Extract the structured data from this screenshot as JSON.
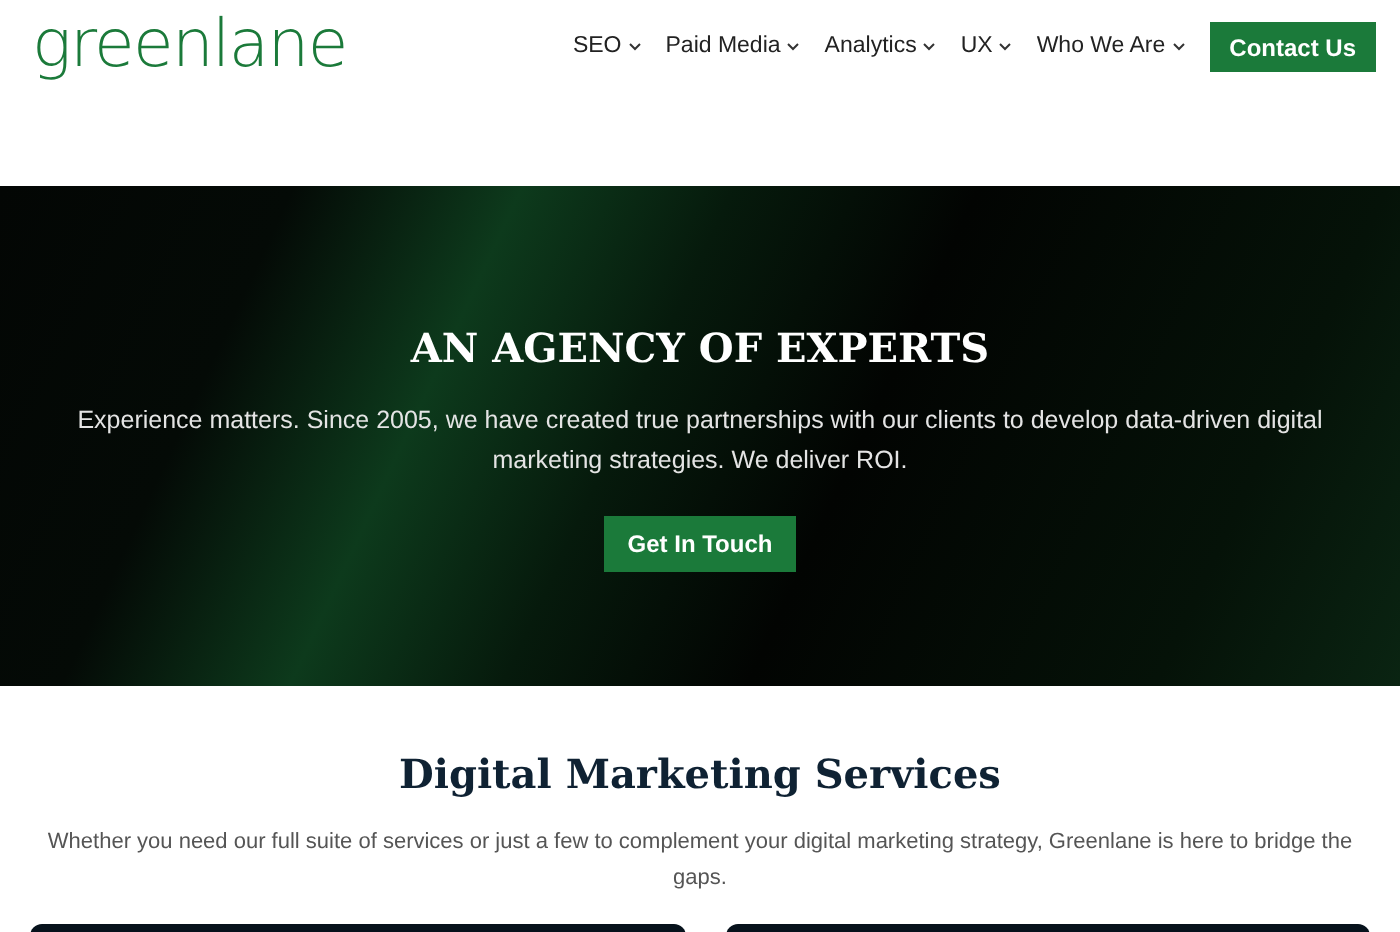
{
  "header": {
    "logo": "greenlane",
    "nav": [
      {
        "label": "SEO",
        "has_dropdown": true
      },
      {
        "label": "Paid Media",
        "has_dropdown": true
      },
      {
        "label": "Analytics",
        "has_dropdown": true
      },
      {
        "label": "UX",
        "has_dropdown": true
      },
      {
        "label": "Who We Are",
        "has_dropdown": true
      }
    ],
    "cta": "Contact Us"
  },
  "hero": {
    "title": "AN AGENCY OF EXPERTS",
    "text": "Experience matters. Since 2005, we have created true partnerships with our clients to develop data-driven digital marketing strategies. We deliver ROI.",
    "button": "Get In Touch"
  },
  "services": {
    "title": "Digital Marketing Services",
    "text": "Whether you need our full suite of services or just a few to complement your digital marketing strategy, Greenlane is here to bridge the gaps."
  }
}
